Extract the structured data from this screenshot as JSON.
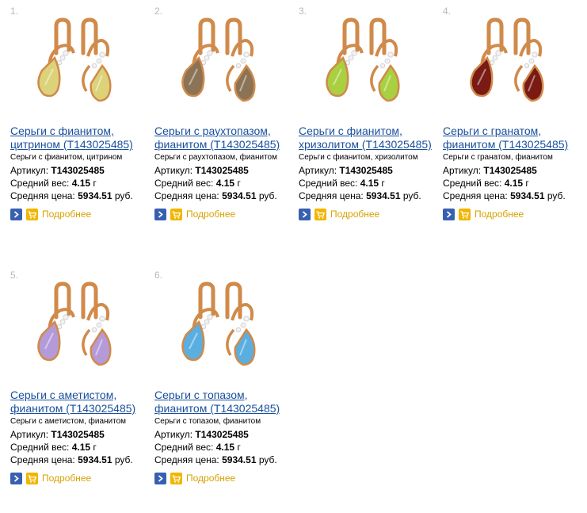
{
  "products": [
    {
      "number": "1.",
      "title_line1": "Серьги с фианитом,",
      "title_line2": "цитрином (T143025485)",
      "subtitle": "Серьги с фианитом, цитрином",
      "article_label": "Артикул:",
      "article": "T143025485",
      "weight_label": "Средний вес:",
      "weight_value": "4.15",
      "weight_unit": "г",
      "price_label": "Средняя цена:",
      "price_value": "5934.51",
      "price_unit": "руб.",
      "details_label": "Подробнее",
      "stone_color": "#dcd27a"
    },
    {
      "number": "2.",
      "title_line1": "Серьги с раухтопазом,",
      "title_line2": "фианитом (T143025485)",
      "subtitle": "Серьги с раухтопазом, фианитом",
      "article_label": "Артикул:",
      "article": "T143025485",
      "weight_label": "Средний вес:",
      "weight_value": "4.15",
      "weight_unit": "г",
      "price_label": "Средняя цена:",
      "price_value": "5934.51",
      "price_unit": "руб.",
      "details_label": "Подробнее",
      "stone_color": "#8b7355"
    },
    {
      "number": "3.",
      "title_line1": "Серьги с фианитом,",
      "title_line2": "хризолитом (T143025485)",
      "subtitle": "Серьги с фианитом, хризолитом",
      "article_label": "Артикул:",
      "article": "T143025485",
      "weight_label": "Средний вес:",
      "weight_value": "4.15",
      "weight_unit": "г",
      "price_label": "Средняя цена:",
      "price_value": "5934.51",
      "price_unit": "руб.",
      "details_label": "Подробнее",
      "stone_color": "#a8d040"
    },
    {
      "number": "4.",
      "title_line1": "Серьги с гранатом,",
      "title_line2": "фианитом (T143025485)",
      "subtitle": "Серьги с гранатом, фианитом",
      "article_label": "Артикул:",
      "article": "T143025485",
      "weight_label": "Средний вес:",
      "weight_value": "4.15",
      "weight_unit": "г",
      "price_label": "Средняя цена:",
      "price_value": "5934.51",
      "price_unit": "руб.",
      "details_label": "Подробнее",
      "stone_color": "#7a1a14"
    },
    {
      "number": "5.",
      "title_line1": "Серьги с аметистом,",
      "title_line2": "фианитом (T143025485)",
      "subtitle": "Серьги с аметистом, фианитом",
      "article_label": "Артикул:",
      "article": "T143025485",
      "weight_label": "Средний вес:",
      "weight_value": "4.15",
      "weight_unit": "г",
      "price_label": "Средняя цена:",
      "price_value": "5934.51",
      "price_unit": "руб.",
      "details_label": "Подробнее",
      "stone_color": "#b49ad8"
    },
    {
      "number": "6.",
      "title_line1": "Серьги с топазом,",
      "title_line2": "фианитом (T143025485)",
      "subtitle": "Серьги с топазом, фианитом",
      "article_label": "Артикул:",
      "article": "T143025485",
      "weight_label": "Средний вес:",
      "weight_value": "4.15",
      "weight_unit": "г",
      "price_label": "Средняя цена:",
      "price_value": "5934.51",
      "price_unit": "руб.",
      "details_label": "Подробнее",
      "stone_color": "#5aaee0"
    }
  ],
  "icons": {
    "go": "arrow-right-icon",
    "cart": "cart-icon"
  },
  "colors": {
    "link": "#1a4f9c",
    "details": "#d7a100",
    "gold": "#d08a4a"
  }
}
